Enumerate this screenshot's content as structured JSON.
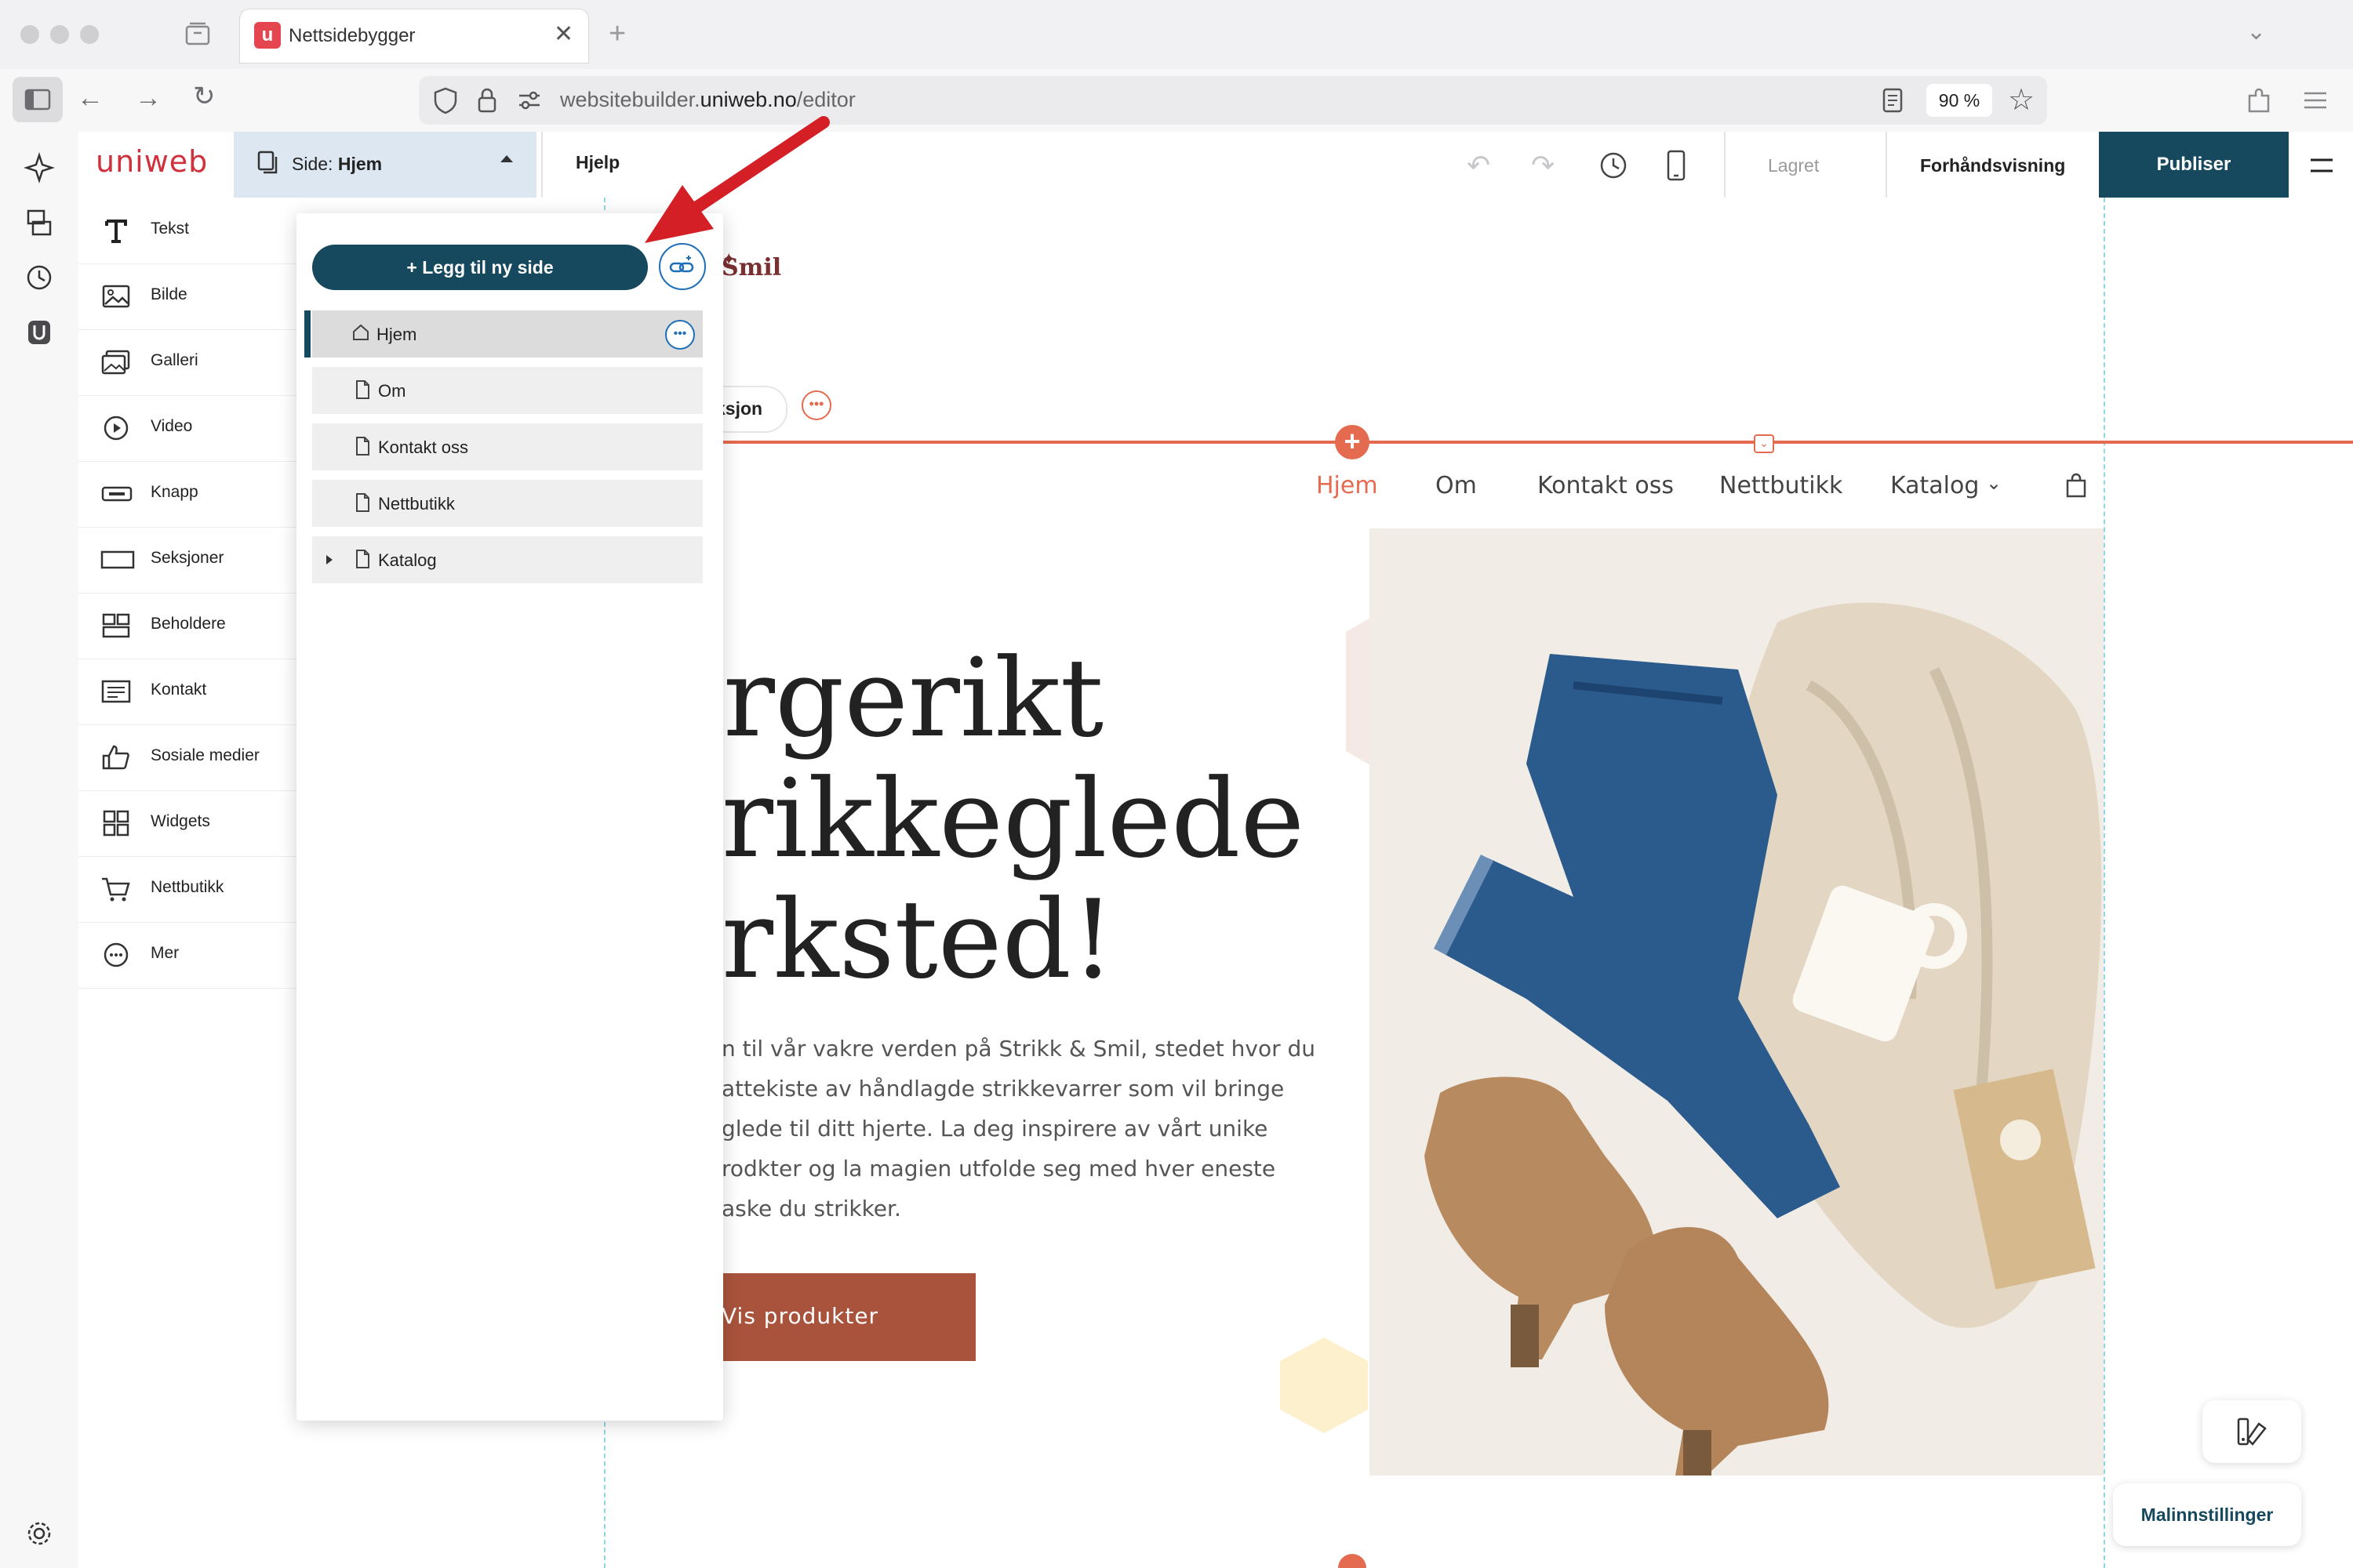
{
  "browser": {
    "tab_title": "Nettsidebygger",
    "url_domain_prefix": "websitebuilder.",
    "url_domain": "uniweb.no",
    "url_path": "/editor",
    "zoom": "90 %"
  },
  "editor": {
    "logo": "uniweb",
    "page_selector_prefix": "Side:",
    "page_selector_value": "Hjem",
    "help_label": "Hjelp",
    "saved_label": "Lagret",
    "preview_label": "Forhåndsvisning",
    "publish_label": "Publiser",
    "template_settings_label": "Malinnstillinger"
  },
  "components": [
    {
      "label": "Tekst",
      "icon": "text-icon"
    },
    {
      "label": "Bilde",
      "icon": "image-icon"
    },
    {
      "label": "Galleri",
      "icon": "gallery-icon"
    },
    {
      "label": "Video",
      "icon": "video-icon"
    },
    {
      "label": "Knapp",
      "icon": "button-icon"
    },
    {
      "label": "Seksjoner",
      "icon": "sections-icon"
    },
    {
      "label": "Beholdere",
      "icon": "containers-icon"
    },
    {
      "label": "Kontakt",
      "icon": "contact-icon"
    },
    {
      "label": "Sosiale medier",
      "icon": "social-media-icon"
    },
    {
      "label": "Widgets",
      "icon": "widgets-icon"
    },
    {
      "label": "Nettbutikk",
      "icon": "cart-icon"
    },
    {
      "label": "Mer",
      "icon": "more-icon"
    }
  ],
  "pages_panel": {
    "add_page_label": "+ Legg til ny side",
    "pages": [
      {
        "label": "Hjem",
        "active": true
      },
      {
        "label": "Om"
      },
      {
        "label": "Kontakt oss"
      },
      {
        "label": "Nettbutikk"
      },
      {
        "label": "Katalog",
        "has_children": true
      }
    ]
  },
  "site": {
    "brand_fragment": "Smil",
    "section_chip_fragment": "ksjon",
    "nav": [
      "Hjem",
      "Om",
      "Kontakt oss",
      "Nettbutikk",
      "Katalog"
    ],
    "hero_line1": "rgerikt",
    "hero_line2": "rikkeglede",
    "hero_line3": "rksted!",
    "body_lines": [
      "n til vår vakre verden på Strikk & Smil, stedet hvor du",
      "attekiste av håndlagde strikkevarrer som vil bringe",
      "glede til ditt hjerte. La deg inspirere av vårt unike",
      "rodkter og la magien utfolde seg med hver eneste",
      "aske du strikker."
    ],
    "cta_label": "Vis produkter"
  },
  "colors": {
    "brand_red": "#d0313d",
    "publish_bg": "#16495e",
    "accent_orange": "#e56b50",
    "cta_bg": "#a9533c",
    "selection_blue": "#1d6fb8"
  }
}
